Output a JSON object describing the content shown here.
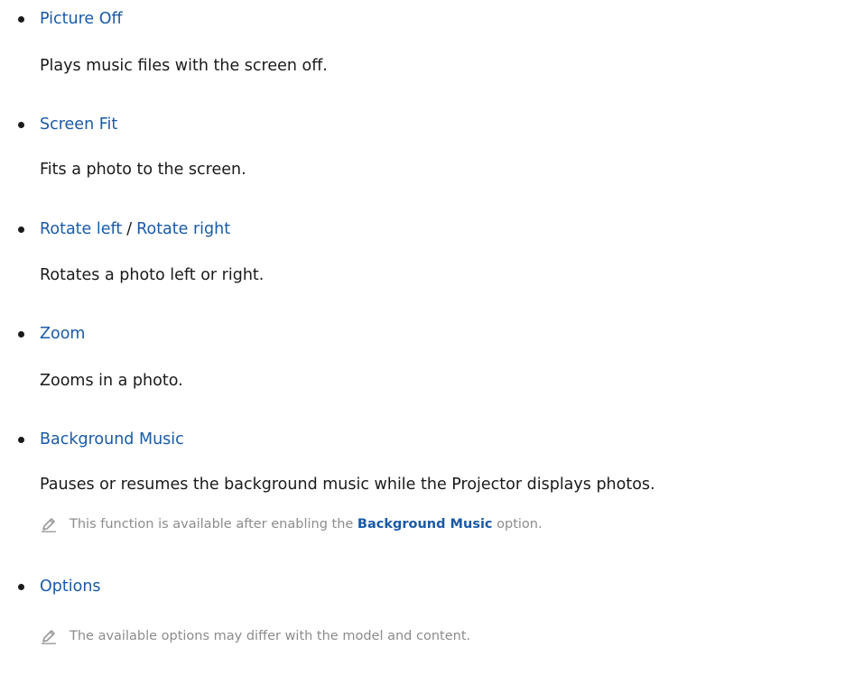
{
  "items": [
    {
      "title": "Picture Off",
      "description": "Plays music files with the screen off."
    },
    {
      "title": "Screen Fit",
      "description": "Fits a photo to the screen."
    },
    {
      "title_left": "Rotate left",
      "title_sep": "/",
      "title_right": "Rotate right",
      "description": "Rotates a photo left or right."
    },
    {
      "title": "Zoom",
      "description": "Zooms in a photo."
    },
    {
      "title": "Background Music",
      "description": "Pauses or resumes the background music while the Projector displays photos.",
      "note": {
        "before": "This function is available after enabling the",
        "highlight": "Background Music",
        "after": "option."
      }
    },
    {
      "title": "Options",
      "note": {
        "text": "The available options may differ with the model and content."
      }
    }
  ],
  "icons": {
    "note_icon": "pencil-icon",
    "bullet_icon": "bullet-dot"
  },
  "colors": {
    "link": "#1a5aa6",
    "text": "#1a1a1a",
    "note": "#8c8c8c"
  }
}
